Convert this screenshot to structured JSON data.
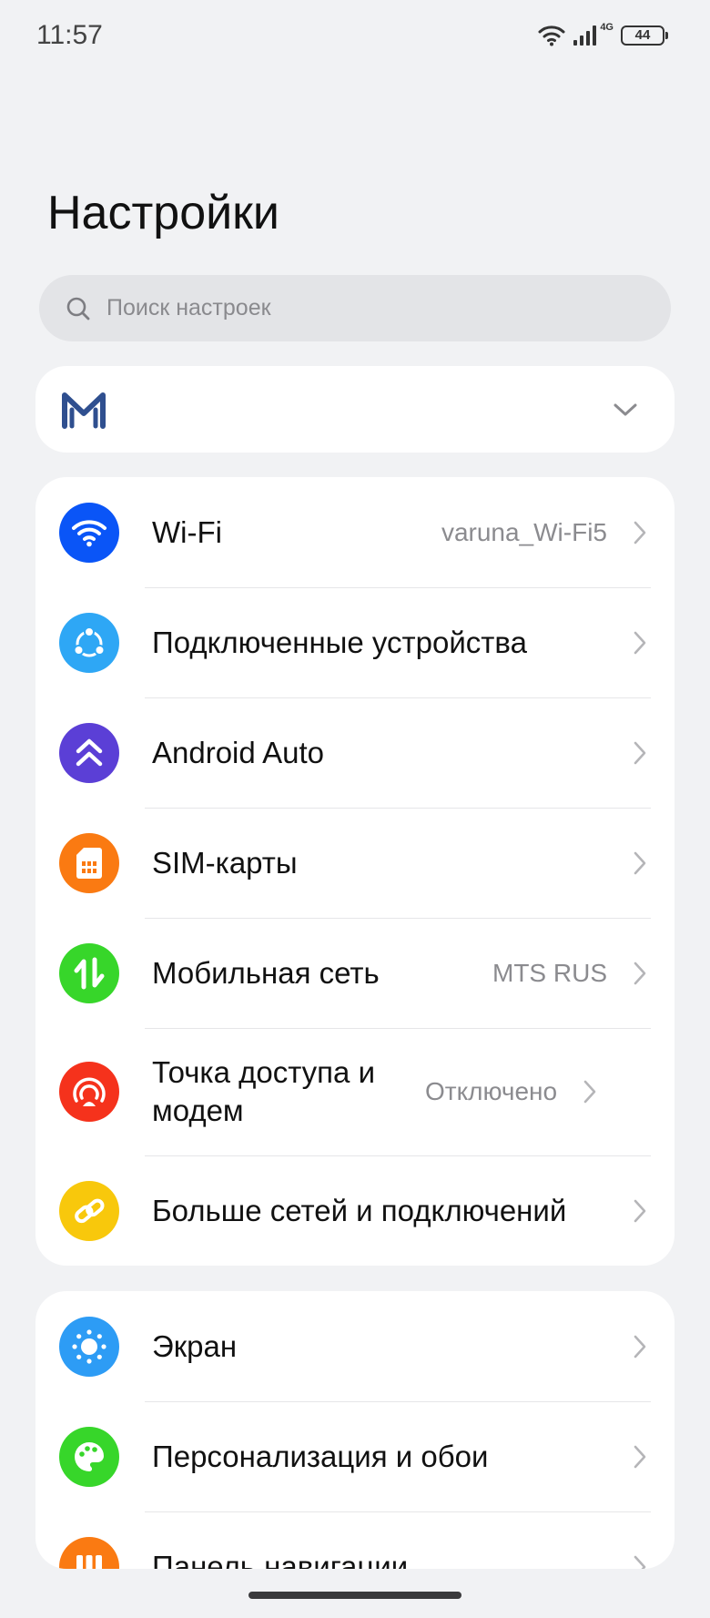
{
  "status_bar": {
    "time": "11:57",
    "network": "4G",
    "battery": "44"
  },
  "page": {
    "title": "Настройки"
  },
  "search": {
    "placeholder": "Поиск настроек",
    "icon": "search-icon"
  },
  "account": {
    "logo": "m-logo",
    "expand_icon": "chevron-down-icon"
  },
  "groups": [
    {
      "items": [
        {
          "label": "Wi-Fi",
          "value": "varuna_Wi-Fi5",
          "icon": "wifi-icon",
          "color": "#0a55f7"
        },
        {
          "label": "Подключенные устройства",
          "value": "",
          "icon": "connected-devices-icon",
          "color": "#2ea7f5"
        },
        {
          "label": "Android Auto",
          "value": "",
          "icon": "android-auto-icon",
          "color": "#5b3fd6"
        },
        {
          "label": "SIM-карты",
          "value": "",
          "icon": "sim-card-icon",
          "color": "#fa7a12"
        },
        {
          "label": "Мобильная сеть",
          "value": "MTS RUS",
          "icon": "mobile-network-icon",
          "color": "#37d62a"
        },
        {
          "label": "Точка доступа и модем",
          "value": "Отключено",
          "icon": "hotspot-icon",
          "color": "#f5321c"
        },
        {
          "label": "Больше сетей и подключений",
          "value": "",
          "icon": "link-icon",
          "color": "#f8c80c"
        }
      ]
    },
    {
      "items": [
        {
          "label": "Экран",
          "value": "",
          "icon": "display-icon",
          "color": "#2d9cf5"
        },
        {
          "label": "Персонализация и обои",
          "value": "",
          "icon": "palette-icon",
          "color": "#37d62a"
        },
        {
          "label": "Панель навигации",
          "value": "",
          "icon": "navigation-bar-icon",
          "color": "#fa7a12"
        }
      ]
    }
  ]
}
